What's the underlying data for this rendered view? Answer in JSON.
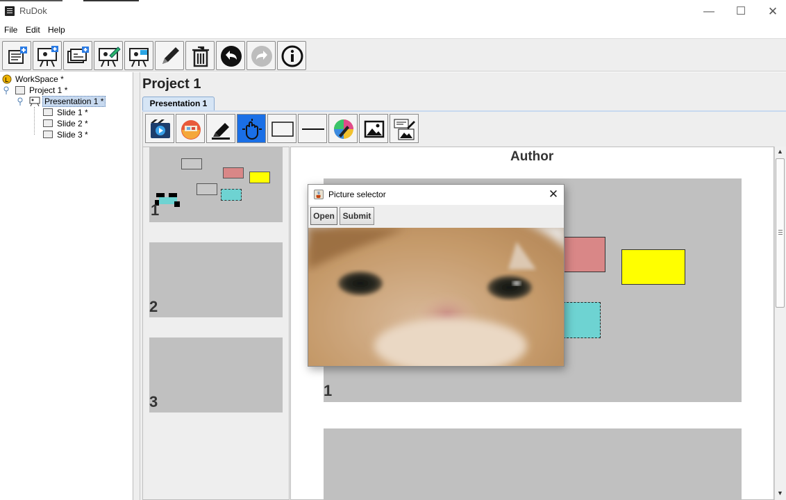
{
  "window": {
    "title": "RuDok",
    "minimize_glyph": "—",
    "maximize_glyph": "☐",
    "close_glyph": "✕"
  },
  "menu": {
    "items": [
      "File",
      "Edit",
      "Help"
    ]
  },
  "toolbar": {
    "buttons": [
      "new-project-icon",
      "new-presentation-icon",
      "new-slide-icon",
      "edit-presentation-icon",
      "share-presentation-icon",
      "rename-pencil-icon",
      "delete-trash-icon",
      "undo-icon",
      "redo-icon",
      "info-icon"
    ]
  },
  "tree": {
    "workspace": "WorkSpace *",
    "project": "Project 1 *",
    "presentation": "Presentation 1 *",
    "slides": [
      "Slide 1 *",
      "Slide 2 *",
      "Slide 3 *"
    ]
  },
  "project": {
    "title": "Project 1",
    "tab_label": "Presentation 1"
  },
  "presentation_toolbar": {
    "buttons": [
      "slideshow-icon",
      "change-theme-icon",
      "pen-icon",
      "move-hand-icon",
      "rectangle-icon",
      "line-icon",
      "color-picker-icon",
      "image-icon",
      "text-image-icon"
    ]
  },
  "thumbnails": [
    "1",
    "2",
    "3"
  ],
  "slide_view": {
    "author": "Author",
    "slide_number": "1"
  },
  "dialog": {
    "title": "Picture selector",
    "close_glyph": "✕",
    "open_label": "Open",
    "submit_label": "Submit"
  },
  "colors": {
    "rect_red": "#d98787",
    "rect_yellow": "#ffff00",
    "rect_cyan": "#6ed3d2",
    "rect_gray": "#c8c8c8",
    "slide_bg": "#c0c0c0",
    "selection": "#c7d9ef"
  }
}
